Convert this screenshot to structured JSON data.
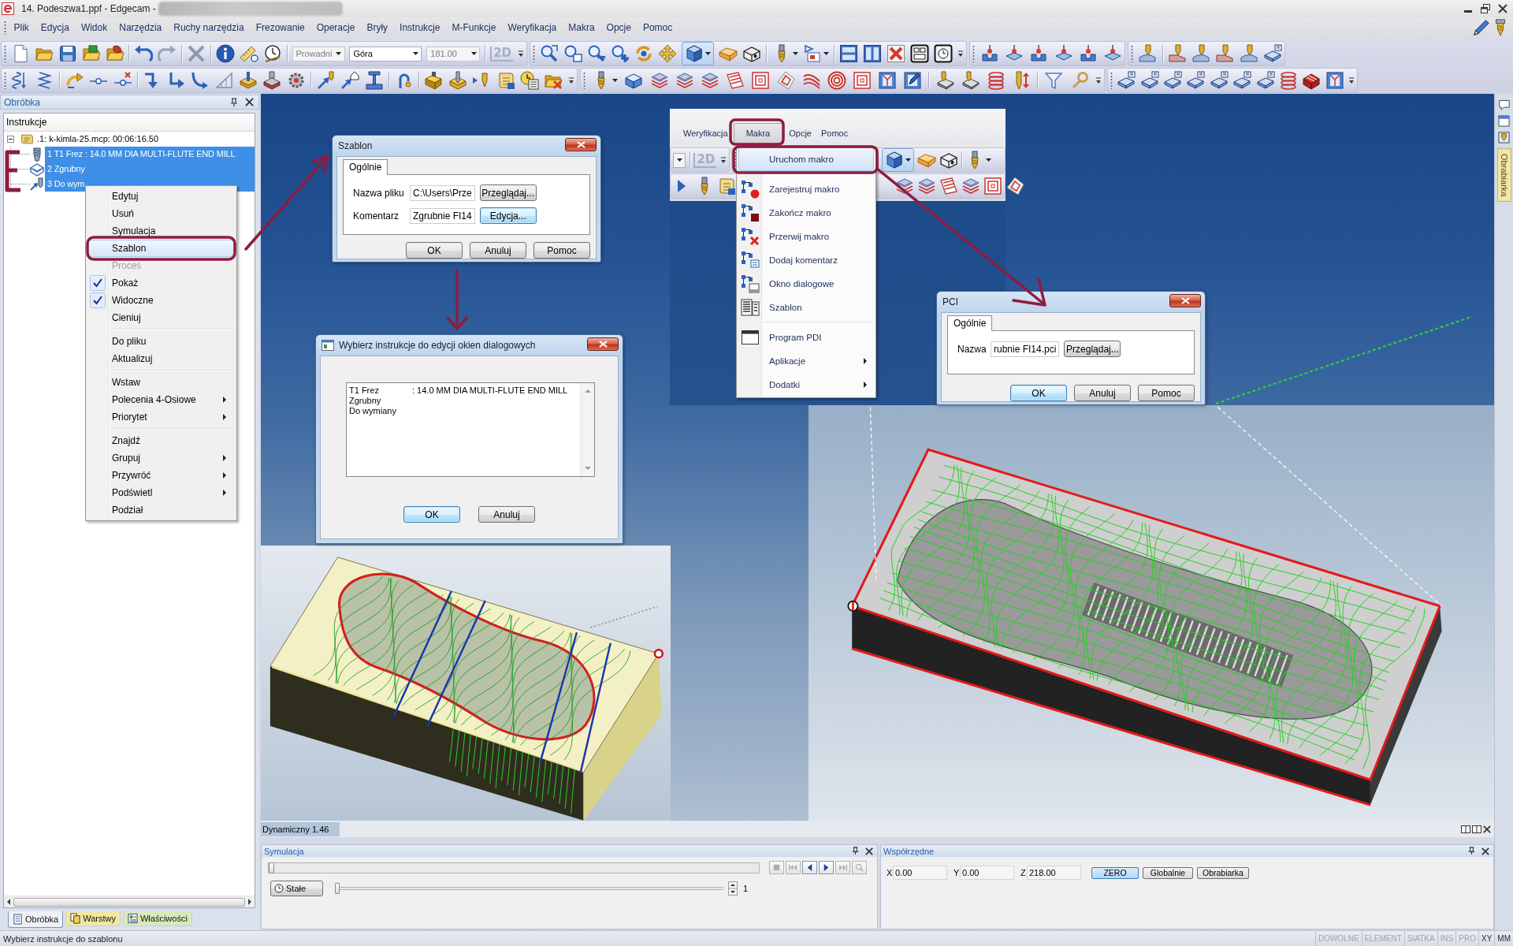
{
  "window": {
    "title": "14. Podeszwa1.ppf - Edgecam -"
  },
  "menu_bar": [
    "Plik",
    "Edycja",
    "Widok",
    "Narzędzia",
    "Ruchy narzędzia",
    "Frezowanie",
    "Operacje",
    "Bryły",
    "Instrukcje",
    "M-Funkcje",
    "Weryfikacja",
    "Makra",
    "Opcje",
    "Pomoc"
  ],
  "toolbar": {
    "combos": [
      {
        "value": "Prowadni",
        "disabled": true
      },
      {
        "value": "Góra",
        "disabled": false
      },
      {
        "value": "181.00",
        "disabled": true
      }
    ],
    "view_2d": "2D"
  },
  "machining_panel": {
    "title": "Obróbka",
    "tree_header": "Instrukcje",
    "tree": [
      {
        "label": ".1: k-kimla-25.mcp: 00:06:16.50",
        "expanded": true,
        "selected": false,
        "children": [
          {
            "label": "1 T1 Frez : 14.0 MM DIA MULTI-FLUTE END MILL",
            "selected": true
          },
          {
            "label": "2 Zgrubny",
            "selected": true
          },
          {
            "label": "3 Do wym",
            "selected": true
          }
        ]
      }
    ],
    "tabs": [
      {
        "label": "Obróbka",
        "selected": true,
        "color": "#eef2f8"
      },
      {
        "label": "Warstwy",
        "selected": false,
        "color": "#f2e7a0"
      },
      {
        "label": "Właściwości",
        "selected": false,
        "color": "#d8e9bd"
      }
    ]
  },
  "context_menu": {
    "groups": [
      [
        {
          "label": "Edytuj",
          "selected": false,
          "disabled": false,
          "checked": false,
          "submenu": false
        },
        {
          "label": "Usuń",
          "selected": false,
          "disabled": false,
          "checked": false,
          "submenu": false
        },
        {
          "label": "Symulacja",
          "selected": false,
          "disabled": false,
          "checked": false,
          "submenu": false
        },
        {
          "label": "Szablon",
          "selected": true,
          "disabled": false,
          "checked": false,
          "submenu": false
        },
        {
          "label": "Proces",
          "selected": false,
          "disabled": true,
          "checked": false,
          "submenu": false
        },
        {
          "label": "Pokaż",
          "selected": false,
          "disabled": false,
          "checked": true,
          "submenu": false
        },
        {
          "label": "Widoczne",
          "selected": false,
          "disabled": false,
          "checked": true,
          "submenu": false
        },
        {
          "label": "Cieniuj",
          "selected": false,
          "disabled": false,
          "checked": false,
          "submenu": false
        }
      ],
      [
        {
          "label": "Do pliku",
          "selected": false,
          "disabled": false,
          "checked": false,
          "submenu": false
        },
        {
          "label": "Aktualizuj",
          "selected": false,
          "disabled": false,
          "checked": false,
          "submenu": false
        }
      ],
      [
        {
          "label": "Wstaw",
          "selected": false,
          "disabled": false,
          "checked": false,
          "submenu": false
        },
        {
          "label": "Polecenia 4-Osiowe",
          "selected": false,
          "disabled": false,
          "checked": false,
          "submenu": true
        },
        {
          "label": "Priorytet",
          "selected": false,
          "disabled": false,
          "checked": false,
          "submenu": true
        }
      ],
      [
        {
          "label": "Znajdź",
          "selected": false,
          "disabled": false,
          "checked": false,
          "submenu": false
        },
        {
          "label": "Grupuj",
          "selected": false,
          "disabled": false,
          "checked": false,
          "submenu": true
        },
        {
          "label": "Przywróć",
          "selected": false,
          "disabled": false,
          "checked": false,
          "submenu": true
        },
        {
          "label": "Podświetl",
          "selected": false,
          "disabled": false,
          "checked": false,
          "submenu": true
        },
        {
          "label": "Podział",
          "selected": false,
          "disabled": false,
          "checked": false,
          "submenu": false
        }
      ]
    ]
  },
  "template_dialog": {
    "title": "Szablon",
    "tabs": [
      {
        "label": "Ogólnie",
        "selected": true
      }
    ],
    "fields": [
      {
        "label": "Nazwa pliku",
        "value": "C:\\Users\\Prze",
        "button": {
          "label": "Przeglądaj...",
          "focused": false
        }
      },
      {
        "label": "Komentarz",
        "value": "Zgrubnie FI14",
        "button": {
          "label": "Edycja...",
          "focused": true
        }
      }
    ],
    "buttons": [
      {
        "label": "OK",
        "focused": false
      },
      {
        "label": "Anuluj",
        "focused": false
      },
      {
        "label": "Pomoc",
        "focused": false
      }
    ]
  },
  "select_dialog": {
    "title": "Wybierz instrukcje do edycji okien dialogowych",
    "list": [
      {
        "name": "T1 Frez",
        "detail": ": 14.0 MM DIA MULTI-FLUTE END MILL"
      },
      {
        "name": "Zgrubny"
      },
      {
        "name": "Do wymiany"
      }
    ],
    "buttons": [
      {
        "label": "OK",
        "focused": true
      },
      {
        "label": "Anuluj",
        "focused": false
      }
    ]
  },
  "macro_screenshot": {
    "menu_bar": [
      {
        "label": "Weryfikacja",
        "selected": false
      },
      {
        "label": "Makra",
        "selected": true
      },
      {
        "label": "Opcje",
        "selected": false
      },
      {
        "label": "Pomoc",
        "selected": false
      }
    ],
    "view_2d": "2D",
    "menu": {
      "groups": [
        [
          {
            "label": "Uruchom makro",
            "selected": true,
            "submenu": false
          }
        ],
        [
          {
            "label": "Zarejestruj makro",
            "selected": false,
            "submenu": false
          },
          {
            "label": "Zakończ makro",
            "selected": false,
            "submenu": false
          },
          {
            "label": "Przerwij makro",
            "selected": false,
            "submenu": false
          },
          {
            "label": "Dodaj komentarz",
            "selected": false,
            "submenu": false
          },
          {
            "label": "Okno dialogowe",
            "selected": false,
            "submenu": false
          },
          {
            "label": "Szablon",
            "selected": false,
            "submenu": false
          }
        ],
        [
          {
            "label": "Program PDI",
            "selected": false,
            "submenu": false
          },
          {
            "label": "Aplikacje",
            "selected": false,
            "submenu": true
          },
          {
            "label": "Dodatki",
            "selected": false,
            "submenu": true
          }
        ]
      ]
    }
  },
  "pci_dialog": {
    "title": "PCI",
    "tabs": [
      {
        "label": "Ogólnie",
        "selected": true
      }
    ],
    "fields": [
      {
        "label": "Nazwa",
        "value": "rubnie FI14.pci",
        "button": {
          "label": "Przeglądaj...",
          "focused": false
        }
      }
    ],
    "buttons": [
      {
        "label": "OK",
        "focused": true
      },
      {
        "label": "Anuluj",
        "focused": false
      },
      {
        "label": "Pomoc",
        "focused": false
      }
    ]
  },
  "viewport": {
    "view_label": "Dynamiczny 1.46"
  },
  "side_tab": "Obrabiarka",
  "simulation_panel": {
    "title": "Symulacja",
    "position": {
      "level": 0
    },
    "controls": [
      {
        "kind": "stop",
        "disabled": true
      },
      {
        "kind": "first",
        "disabled": true
      },
      {
        "kind": "previous",
        "disabled": false
      },
      {
        "kind": "next",
        "disabled": false
      },
      {
        "kind": "last",
        "disabled": true
      },
      {
        "kind": "find",
        "disabled": true
      }
    ],
    "mode_button": "Stałe",
    "speed": {
      "level": 0
    },
    "step": "1"
  },
  "coordinates_panel": {
    "title": "Współrzędne",
    "fields": [
      {
        "label": "X",
        "value": "0.00"
      },
      {
        "label": "Y",
        "value": "0.00"
      },
      {
        "label": "Z",
        "value": "218.00"
      }
    ],
    "buttons": [
      {
        "label": "ZERO",
        "selected": true
      },
      {
        "label": "Globalnie",
        "selected": false
      },
      {
        "label": "Obrabiarka",
        "selected": false
      }
    ]
  },
  "status_bar": {
    "message": "Wybierz instrukcje do szablonu",
    "indicators": [
      {
        "label": "DOWOLNE",
        "on": false
      },
      {
        "label": "ELEMENT",
        "on": false
      },
      {
        "label": "SIATKA",
        "on": false
      },
      {
        "label": "INS",
        "on": false
      },
      {
        "label": "PRO",
        "on": false
      },
      {
        "label": "XY",
        "on": true
      },
      {
        "label": "MM",
        "on": true
      }
    ]
  }
}
